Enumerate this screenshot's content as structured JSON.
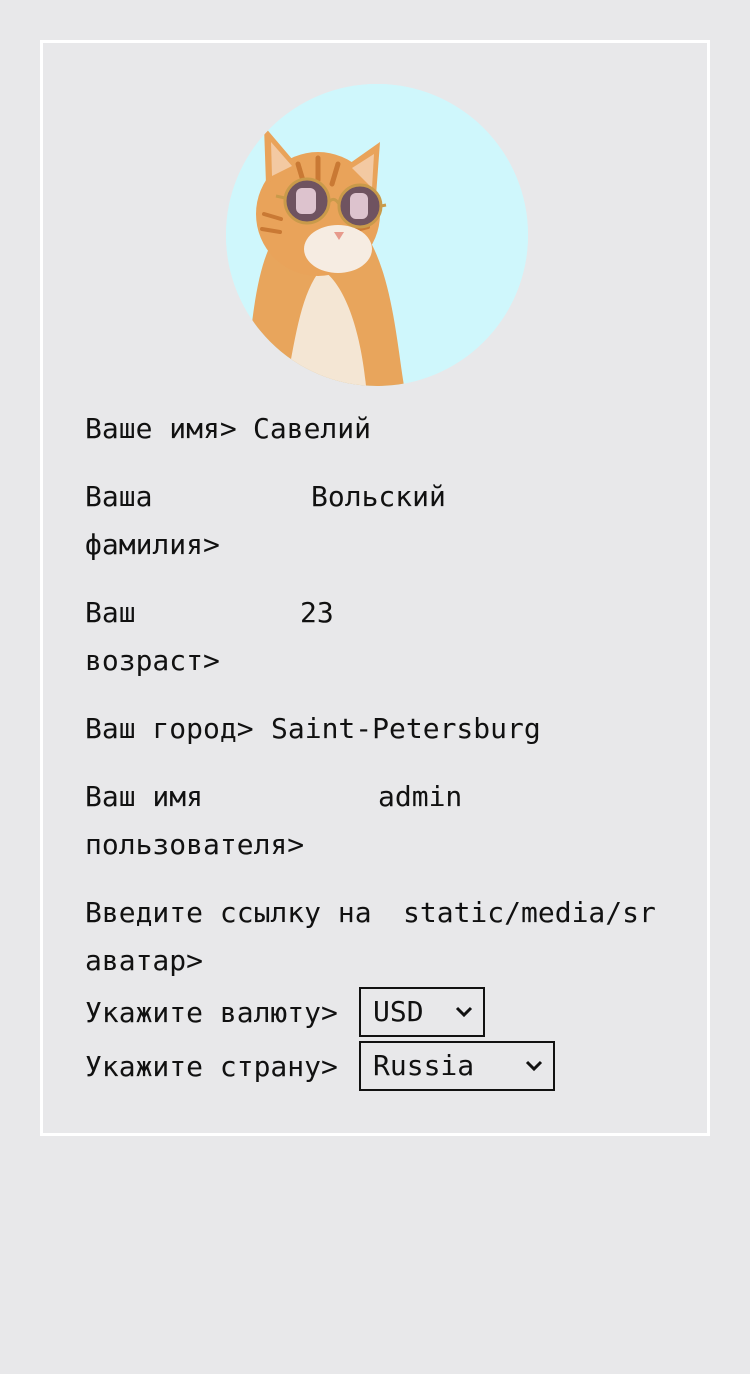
{
  "profile": {
    "first_name": {
      "label": "Ваше имя>",
      "value": "Савелий"
    },
    "last_name": {
      "label": "Ваша фамилия>",
      "value": "Вольский"
    },
    "age": {
      "label": "Ваш возраст>",
      "value": "23"
    },
    "city": {
      "label": "Ваш город>",
      "value": "Saint-Petersburg"
    },
    "username": {
      "label": "Ваш имя пользователя>",
      "value": "admin"
    },
    "avatar_link": {
      "label": "Введите ссылку на аватар>",
      "value": "static/media/sr"
    },
    "currency": {
      "label": "Укажите валюту>",
      "selected": "USD"
    },
    "country": {
      "label": "Укажите страну>",
      "selected": "Russia"
    }
  },
  "avatar": {
    "icon": "cat-with-sunglasses-avatar",
    "bg": "#cff7fc"
  },
  "colors": {
    "page_bg": "#e8e8ea",
    "card_border": "#ffffff",
    "text": "#111111"
  }
}
